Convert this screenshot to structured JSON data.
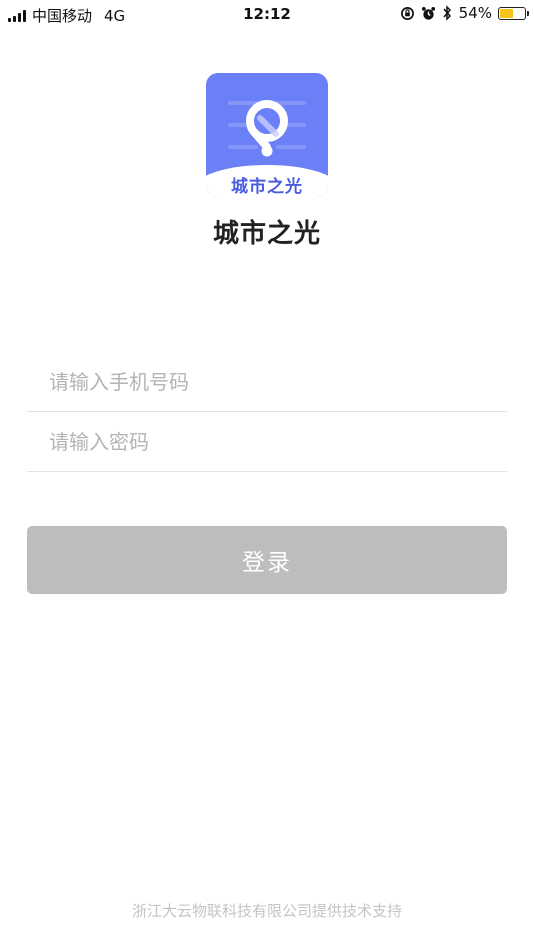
{
  "status_bar": {
    "carrier": "中国移动",
    "network": "4G",
    "time": "12:12",
    "battery_percent": "54%",
    "battery_level": 0.54,
    "icons": [
      "rotation-lock-icon",
      "alarm-icon",
      "bluetooth-icon",
      "battery-icon"
    ]
  },
  "logo": {
    "text": "城市之光",
    "icon": "location-pin-icon",
    "color": "#6b7ff6"
  },
  "app": {
    "title": "城市之光"
  },
  "form": {
    "phone_placeholder": "请输入手机号码",
    "password_placeholder": "请输入密码",
    "login_label": "登录"
  },
  "footer": {
    "text": "浙江大云物联科技有限公司提供技术支持"
  }
}
